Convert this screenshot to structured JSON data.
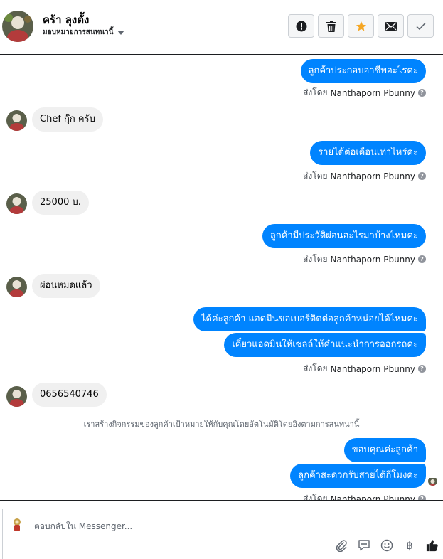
{
  "header": {
    "contact_name": "คร้า ลุงตั้ง",
    "assign_label": "มอบหมายการสนทนานี้",
    "actions": [
      {
        "name": "mark-spam-button",
        "icon": "alert-icon"
      },
      {
        "name": "delete-button",
        "icon": "trash-icon"
      },
      {
        "name": "star-button",
        "icon": "star-icon",
        "color": "#f5a623"
      },
      {
        "name": "mark-unread-button",
        "icon": "envelope-icon"
      },
      {
        "name": "mark-done-button",
        "icon": "check-icon"
      }
    ]
  },
  "thread": {
    "sent_by_prefix": "ส่งโดย",
    "sender": "Nanthaporn Pbunny",
    "m1": "ลูกค้าประกอบอาชีพอะไรคะ",
    "m2": "Chef กุ๊ก ครับ",
    "m3": "รายได้ต่อเดือนเท่าไหร่คะ",
    "m4": "25000 บ.",
    "m5": "ลูกค้ามีประวัติผ่อนอะไรมาบ้างไหมคะ",
    "m6": "ผ่อนหมดแล้ว",
    "m7": "ได้ค่ะลูกค้า แอดมินขอเบอร์ติดต่อลูกค้าหน่อยได้ไหมคะ",
    "m8": "เดี๋ยวแอดมินให้เซลล์ให้คำแนะนำการออกรถค่ะ",
    "m9": "0656540746",
    "system_note": "เราสร้างกิจกรรมของลูกค้าเป้าหมายให้กับคุณโดยอัตโนมัติโดยอิงตามการสนทนานี้",
    "m10": "ขอบคุณค่ะลูกค้า",
    "m11": "ลูกค้าสะดวกรับสายได้กี่โมงคะ"
  },
  "composer": {
    "placeholder": "ตอบกลับใน Messenger...",
    "tools": [
      "paperclip-icon",
      "sticker-icon",
      "emoji-icon",
      "baht-icon",
      "thumbs-up-icon"
    ],
    "baht_symbol": "฿"
  },
  "colors": {
    "outgoing_bubble": "#0084ff",
    "incoming_bubble": "#f0f0f0",
    "star": "#f5a623"
  }
}
